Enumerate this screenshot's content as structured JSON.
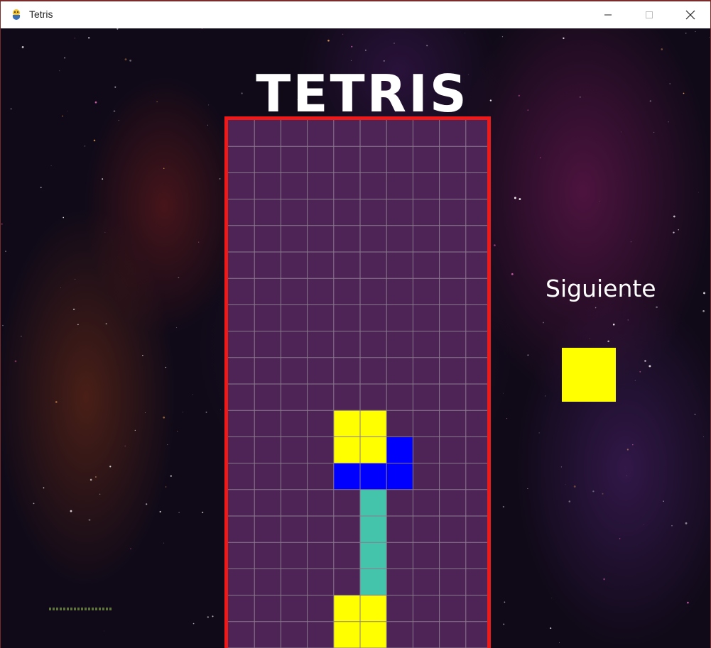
{
  "window": {
    "title": "Tetris",
    "icon": "pygame-snake-icon",
    "controls": [
      "minimize-icon",
      "maximize-icon",
      "close-icon"
    ]
  },
  "game": {
    "title": "TETRIS",
    "next_label": "Siguiente",
    "next_piece": {
      "color": "#ffff00",
      "cells": [
        [
          0,
          0
        ]
      ]
    }
  },
  "board": {
    "columns": 10,
    "rows": 20,
    "background_color": "#4e2456",
    "grid_color": "#8a7a8e",
    "border_color": "#ee1a1a",
    "filled_cells": [
      {
        "row": 11,
        "col": 4,
        "color": "#ffff00"
      },
      {
        "row": 11,
        "col": 5,
        "color": "#ffff00"
      },
      {
        "row": 12,
        "col": 4,
        "color": "#ffff00"
      },
      {
        "row": 12,
        "col": 5,
        "color": "#ffff00"
      },
      {
        "row": 12,
        "col": 6,
        "color": "#0000ff"
      },
      {
        "row": 13,
        "col": 4,
        "color": "#0000ff"
      },
      {
        "row": 13,
        "col": 5,
        "color": "#0000ff"
      },
      {
        "row": 13,
        "col": 6,
        "color": "#0000ff"
      },
      {
        "row": 14,
        "col": 5,
        "color": "#44c4aa"
      },
      {
        "row": 15,
        "col": 5,
        "color": "#44c4aa"
      },
      {
        "row": 16,
        "col": 5,
        "color": "#44c4aa"
      },
      {
        "row": 17,
        "col": 5,
        "color": "#44c4aa"
      },
      {
        "row": 18,
        "col": 4,
        "color": "#ffff00"
      },
      {
        "row": 18,
        "col": 5,
        "color": "#ffff00"
      },
      {
        "row": 19,
        "col": 4,
        "color": "#ffff00"
      },
      {
        "row": 19,
        "col": 5,
        "color": "#ffff00"
      }
    ]
  }
}
